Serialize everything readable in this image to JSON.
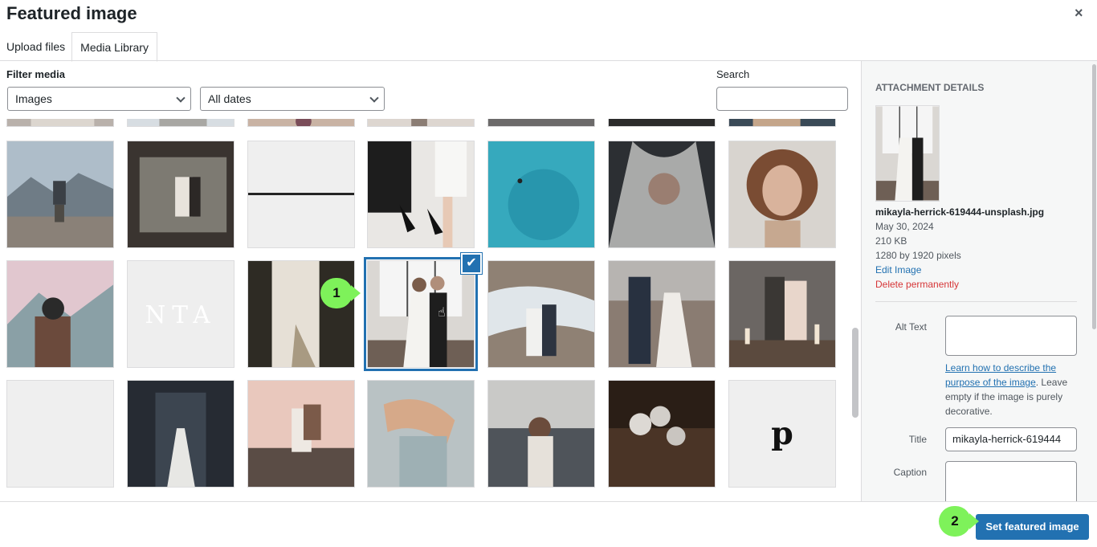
{
  "modal": {
    "title": "Featured image",
    "close_symbol": "×"
  },
  "tabs": [
    {
      "label": "Upload files",
      "active": false
    },
    {
      "label": "Media Library",
      "active": true
    }
  ],
  "toolbar": {
    "filter_label": "Filter media",
    "type_selected": "Images",
    "date_selected": "All dates",
    "search_label": "Search",
    "search_value": ""
  },
  "grid": {
    "rows": [
      [
        "portrait-1",
        "portrait-2",
        "flowers-1",
        "couple-legs",
        "dark-1",
        "dark-2",
        "portrait-3"
      ],
      [
        "man-at-lake",
        "couple-through-window",
        "blank-line",
        "couple-holding-shoes",
        "aerial-ocean-swimmer",
        "veiled-bride",
        "curly-hair-woman"
      ],
      [
        "hat-man-mountains",
        "monta-text",
        "bride-bouquet-dress",
        "mikayla-herrick-619444-unsplash",
        "couple-beach-cliffs",
        "couple-walking-beach",
        "couple-candles"
      ],
      [
        "blank-light",
        "bride-dark-arch",
        "piggyback-sunset",
        "couple-hands-rings",
        "wedding-crowd",
        "roses-table",
        "pinterest-logo"
      ]
    ],
    "selected_id": "mikayla-herrick-619444-unsplash",
    "check_symbol": "✔"
  },
  "details": {
    "heading": "Attachment Details",
    "filename": "mikayla-herrick-619444-unsplash.jpg",
    "date": "May 30, 2024",
    "size": "210 KB",
    "dimensions": "1280 by 1920 pixels",
    "edit_link": "Edit Image",
    "delete_link": "Delete permanently",
    "alt_label": "Alt Text",
    "alt_value": "",
    "help_link": "Learn how to describe the purpose of the image",
    "help_text": ". Leave empty if the image is purely decorative.",
    "title_label": "Title",
    "title_value": "mikayla-herrick-619444",
    "caption_label": "Caption",
    "caption_value": ""
  },
  "footer": {
    "button_label": "Set featured image"
  },
  "steps": [
    "1",
    "2"
  ],
  "colors": {
    "accent": "#2271b1",
    "danger": "#d63638",
    "step_marker": "#7ef25a"
  }
}
